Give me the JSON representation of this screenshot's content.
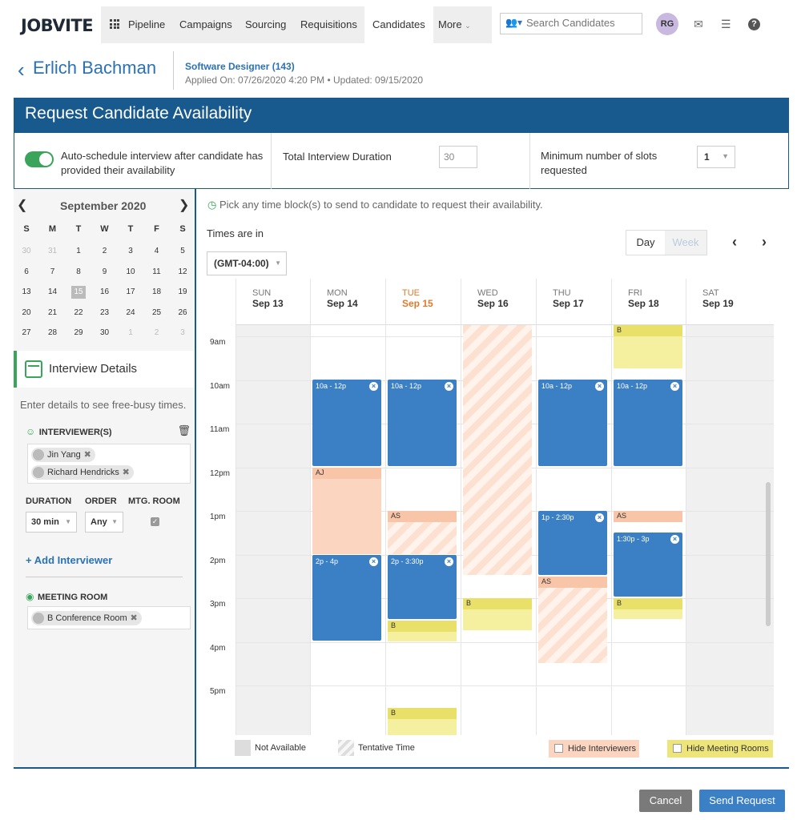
{
  "app": {
    "logo": "JOBVITE"
  },
  "nav": {
    "items": [
      "Pipeline",
      "Campaigns",
      "Sourcing",
      "Requisitions",
      "Candidates",
      "More"
    ],
    "active": "Candidates",
    "search_placeholder": "Search Candidates",
    "avatar": "RG",
    "icons": [
      "grid-icon",
      "mail-icon",
      "tasks-icon",
      "help-icon"
    ]
  },
  "candidate": {
    "name": "Erlich Bachman",
    "job": "Software Designer (143)",
    "dates": "Applied On: 07/26/2020 4:20 PM  •  Updated: 09/15/2020"
  },
  "banner": {
    "title": "Request Candidate Availability"
  },
  "settings": {
    "auto_schedule": "Auto-schedule interview after candidate has provided their availability",
    "auto_schedule_on": true,
    "duration_label": "Total Interview Duration",
    "duration_value": "30",
    "min_slots_label": "Minimum number of slots requested",
    "min_slots_value": "1"
  },
  "mini_calendar": {
    "month": "September 2020",
    "dow": [
      "S",
      "M",
      "T",
      "W",
      "T",
      "F",
      "S"
    ],
    "weeks": [
      [
        "30",
        "31",
        "1",
        "2",
        "3",
        "4",
        "5"
      ],
      [
        "6",
        "7",
        "8",
        "9",
        "10",
        "11",
        "12"
      ],
      [
        "13",
        "14",
        "15",
        "16",
        "17",
        "18",
        "19"
      ],
      [
        "20",
        "21",
        "22",
        "23",
        "24",
        "25",
        "26"
      ],
      [
        "27",
        "28",
        "29",
        "30",
        "1",
        "2",
        "3"
      ]
    ],
    "selected": "15"
  },
  "interview_details": {
    "title": "Interview Details",
    "hint": "Enter details to see free-busy times.",
    "interviewers_label": "INTERVIEWER(S)",
    "interviewers": [
      "Jin Yang",
      "Richard Hendricks"
    ],
    "duration_label": "DURATION",
    "duration_value": "30 min",
    "order_label": "ORDER",
    "order_value": "Any",
    "room_label": "MTG. ROOM",
    "room_checked": true,
    "add_interviewer": "Add Interviewer",
    "meeting_room_label": "MEETING ROOM",
    "meeting_rooms": [
      "B Conference Room"
    ]
  },
  "scheduler": {
    "pick_hint": "Pick any time block(s) to send to candidate to request their availability.",
    "times_in": "Times are in",
    "timezone": "(GMT-04:00)",
    "view_day": "Day",
    "view_week": "Week",
    "days": [
      {
        "dow": "SUN",
        "date": "Sep 13"
      },
      {
        "dow": "MON",
        "date": "Sep 14"
      },
      {
        "dow": "TUE",
        "date": "Sep 15"
      },
      {
        "dow": "WED",
        "date": "Sep 16"
      },
      {
        "dow": "THU",
        "date": "Sep 17"
      },
      {
        "dow": "FRI",
        "date": "Sep 18"
      },
      {
        "dow": "SAT",
        "date": "Sep 19"
      }
    ],
    "today": "TUE",
    "hours": [
      "9am",
      "10am",
      "11am",
      "12pm",
      "1pm",
      "2pm",
      "3pm",
      "4pm",
      "5pm"
    ],
    "blocks": {
      "mon1": "10a - 12p",
      "tue1": "10a - 12p",
      "thu1": "10a - 12p",
      "fri1": "10a - 12p",
      "mon2": "2p - 4p",
      "tue2": "2p - 3:30p",
      "thu2": "1p - 2:30p",
      "fri2": "1:30p - 3p",
      "aj": "AJ",
      "as": "AS",
      "b": "B"
    }
  },
  "legend": {
    "not_available": "Not Available",
    "tentative": "Tentative Time",
    "hide_interviewers": "Hide Interviewers",
    "hide_rooms": "Hide Meeting Rooms"
  },
  "footer": {
    "cancel": "Cancel",
    "send": "Send Request"
  },
  "colors": {
    "brand": "#195a8e",
    "accent": "#2a72b5",
    "block": "#3b7fc4",
    "today": "#e07a2a"
  }
}
